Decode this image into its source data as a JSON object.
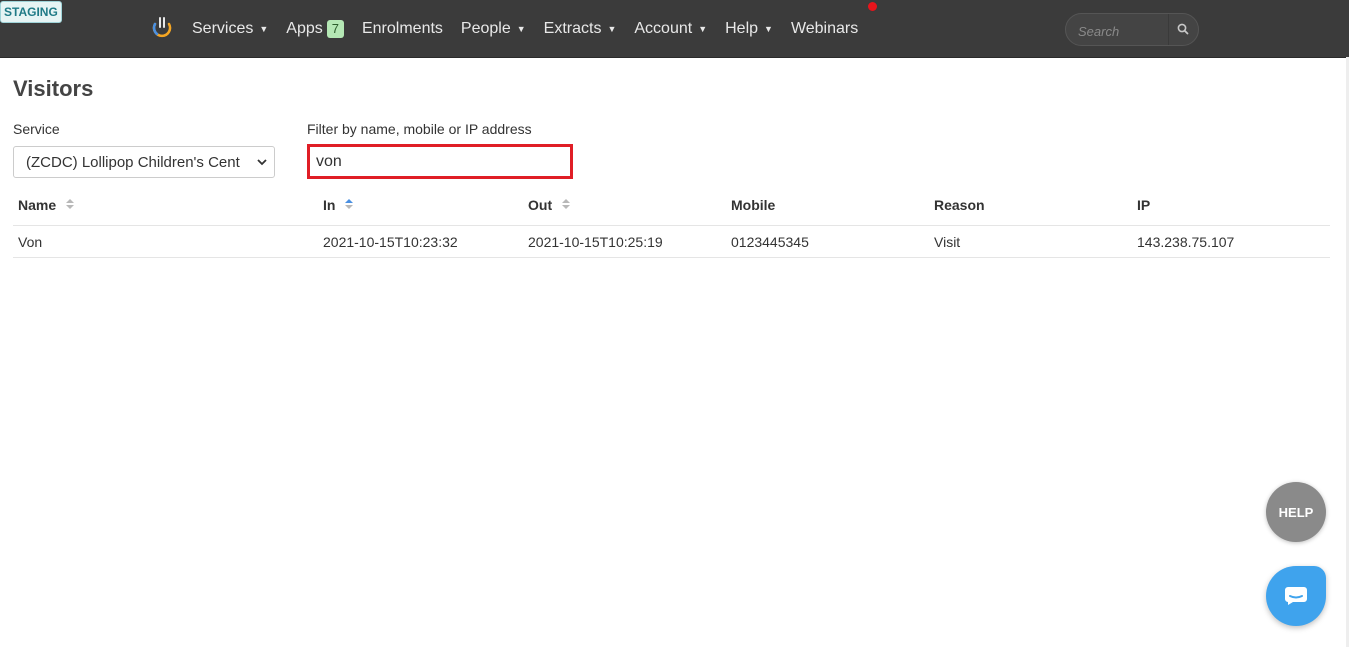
{
  "env_badge": "STAGING",
  "nav": {
    "items": [
      {
        "label": "Services",
        "dropdown": true
      },
      {
        "label": "Apps",
        "badge": "7"
      },
      {
        "label": "Enrolments"
      },
      {
        "label": "People",
        "dropdown": true
      },
      {
        "label": "Extracts",
        "dropdown": true
      },
      {
        "label": "Account",
        "dropdown": true
      },
      {
        "label": "Help",
        "dropdown": true
      },
      {
        "label": "Webinars",
        "notification_dot": true
      }
    ],
    "search_placeholder": "Search",
    "colors": {
      "bar": "#3b3b3b",
      "notification": "#e8141b",
      "badge": "#b5e8b5"
    }
  },
  "page": {
    "title": "Visitors",
    "service": {
      "label": "Service",
      "selected": "(ZCDC) Lollipop Children's Cent"
    },
    "filter": {
      "label": "Filter by name, mobile or IP address",
      "value": "von",
      "highlight_color": "#e01e26"
    }
  },
  "table": {
    "columns": [
      {
        "label": "Name",
        "sort": "none"
      },
      {
        "label": "In",
        "sort": "asc"
      },
      {
        "label": "Out",
        "sort": "none"
      },
      {
        "label": "Mobile"
      },
      {
        "label": "Reason"
      },
      {
        "label": "IP"
      }
    ],
    "rows": [
      [
        "Von",
        "2021-10-15T10:23:32",
        "2021-10-15T10:25:19",
        "0123445345",
        "Visit",
        "143.238.75.107"
      ]
    ]
  },
  "widgets": {
    "help_label": "HELP",
    "chat_color": "#3fa3ed"
  }
}
